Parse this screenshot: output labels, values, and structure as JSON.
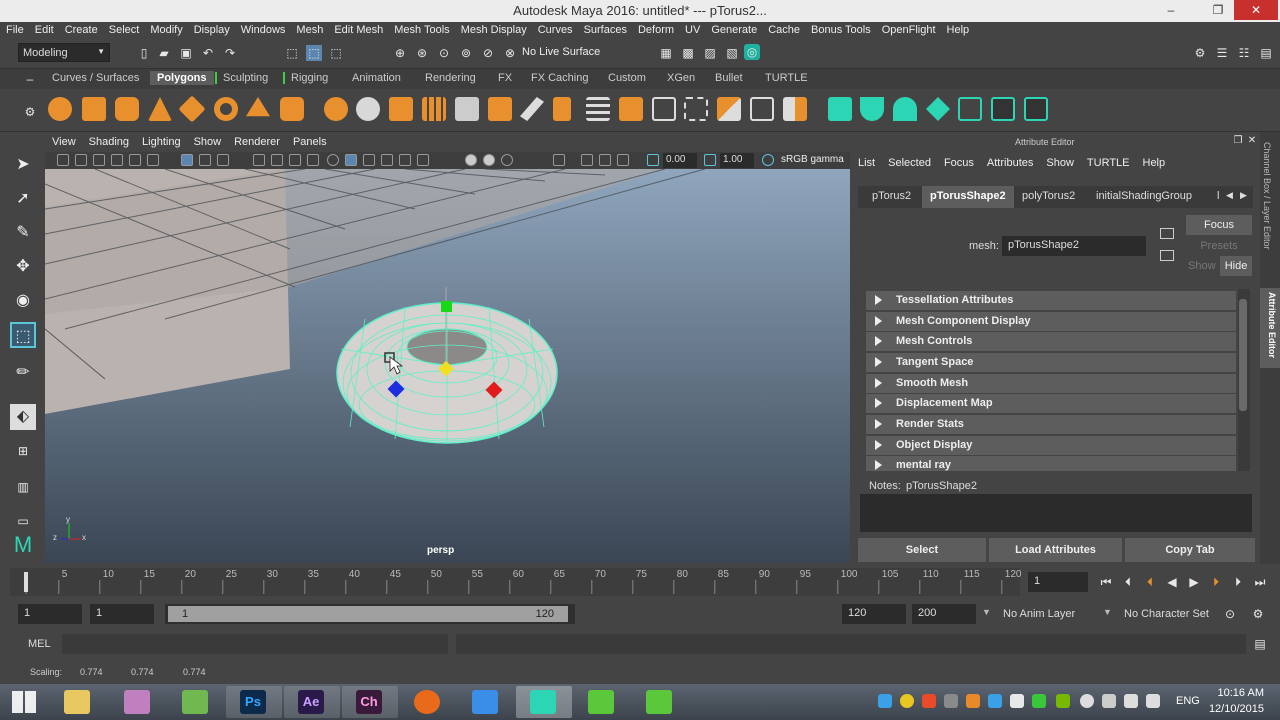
{
  "window": {
    "title": "Autodesk Maya 2016: untitled*   ---   pTorus2...",
    "minimize": "–",
    "maximize": "❐",
    "close": "✕"
  },
  "menubar": [
    "File",
    "Edit",
    "Create",
    "Select",
    "Modify",
    "Display",
    "Windows",
    "Mesh",
    "Edit Mesh",
    "Mesh Tools",
    "Mesh Display",
    "Curves",
    "Surfaces",
    "Deform",
    "UV",
    "Generate",
    "Cache",
    "Bonus Tools",
    "OpenFlight",
    "Help"
  ],
  "statusline": {
    "menuset": "Modeling",
    "live_surface": "No Live Surface"
  },
  "shelf_tabs": [
    "Curves / Surfaces",
    "Polygons",
    "Sculpting",
    "Rigging",
    "Animation",
    "Rendering",
    "FX",
    "FX Caching",
    "Custom",
    "XGen",
    "Bullet",
    "TURTLE"
  ],
  "active_shelf": "Polygons",
  "panel_menu": [
    "View",
    "Shading",
    "Lighting",
    "Show",
    "Renderer",
    "Panels"
  ],
  "panel_toolbar": {
    "exposure": "0.00",
    "gamma": "1.00",
    "colorspace": "sRGB gamma"
  },
  "viewport": {
    "camera_label": "persp",
    "axis_y": "y",
    "axis_x": "x",
    "axis_z": "z"
  },
  "attribute_editor": {
    "title": "Attribute Editor",
    "menu": [
      "List",
      "Selected",
      "Focus",
      "Attributes",
      "Show",
      "TURTLE",
      "Help"
    ],
    "tabs": [
      "pTorus2",
      "pTorusShape2",
      "polyTorus2",
      "initialShadingGroup",
      "l"
    ],
    "active_tab": "pTorusShape2",
    "mesh_label": "mesh:",
    "mesh_value": "pTorusShape2",
    "focus": "Focus",
    "presets": "Presets",
    "show": "Show",
    "hide": "Hide",
    "sections": [
      "Tessellation Attributes",
      "Mesh Component Display",
      "Mesh Controls",
      "Tangent Space",
      "Smooth Mesh",
      "Displacement Map",
      "Render Stats",
      "Object Display",
      "mental ray"
    ],
    "notes_label": "Notes:",
    "notes_value": "pTorusShape2",
    "buttons": {
      "select": "Select",
      "load": "Load Attributes",
      "copy": "Copy Tab"
    }
  },
  "side_tabs": {
    "channel_box": "Channel Box / Layer Editor",
    "attribute_editor": "Attribute Editor"
  },
  "timeline": {
    "ticks": [
      "1",
      "5",
      "10",
      "15",
      "20",
      "25",
      "30",
      "35",
      "40",
      "45",
      "50",
      "55",
      "60",
      "65",
      "70",
      "75",
      "80",
      "85",
      "90",
      "95",
      "100",
      "105",
      "110",
      "115",
      "120"
    ],
    "current_frame": "1"
  },
  "range": {
    "start": "1",
    "start_inner": "1",
    "range_start": "1",
    "range_end": "120",
    "end_inner": "120",
    "end": "200",
    "anim_layer": "No Anim Layer",
    "char_set": "No Character Set"
  },
  "mel": {
    "label": "MEL"
  },
  "help": {
    "label": "Scaling:",
    "x": "0.774",
    "y": "0.774",
    "z": "0.774"
  },
  "taskbar": {
    "apps": [
      "Ps",
      "Ae",
      "Ch"
    ],
    "lang": "ENG",
    "time": "10:16 AM",
    "date": "12/10/2015"
  },
  "colors": {
    "accent": "#5bc6d8",
    "torus_wire": "#5ef0c8",
    "manip_green": "#18d818",
    "manip_red": "#e01c1c",
    "manip_blue": "#1c2ee0",
    "manip_yellow": "#f0e020"
  }
}
